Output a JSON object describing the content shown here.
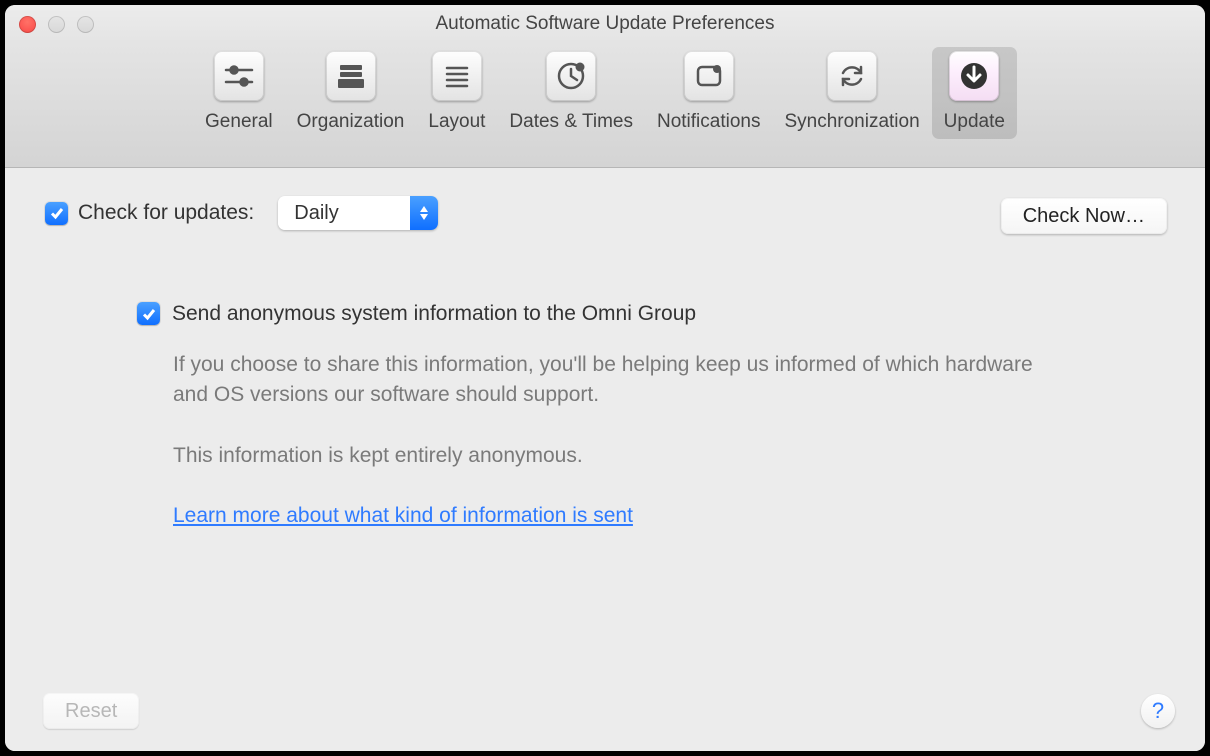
{
  "window": {
    "title": "Automatic Software Update Preferences"
  },
  "toolbar": {
    "items": [
      {
        "label": "General"
      },
      {
        "label": "Organization"
      },
      {
        "label": "Layout"
      },
      {
        "label": "Dates & Times"
      },
      {
        "label": "Notifications"
      },
      {
        "label": "Synchronization"
      },
      {
        "label": "Update"
      }
    ],
    "selected_index": 6
  },
  "update": {
    "check_checkbox_checked": true,
    "check_label": "Check for updates:",
    "frequency_selected": "Daily",
    "check_now_label": "Check Now…",
    "send_checkbox_checked": true,
    "send_label": "Send anonymous system information to the Omni Group",
    "desc_line1": "If you choose to share this information, you'll be helping keep us informed of which hardware and OS versions our software should support.",
    "desc_line2": "This information is kept entirely anonymous.",
    "learn_more": "Learn more about what kind of information is sent"
  },
  "footer": {
    "reset_label": "Reset",
    "help_label": "?"
  }
}
